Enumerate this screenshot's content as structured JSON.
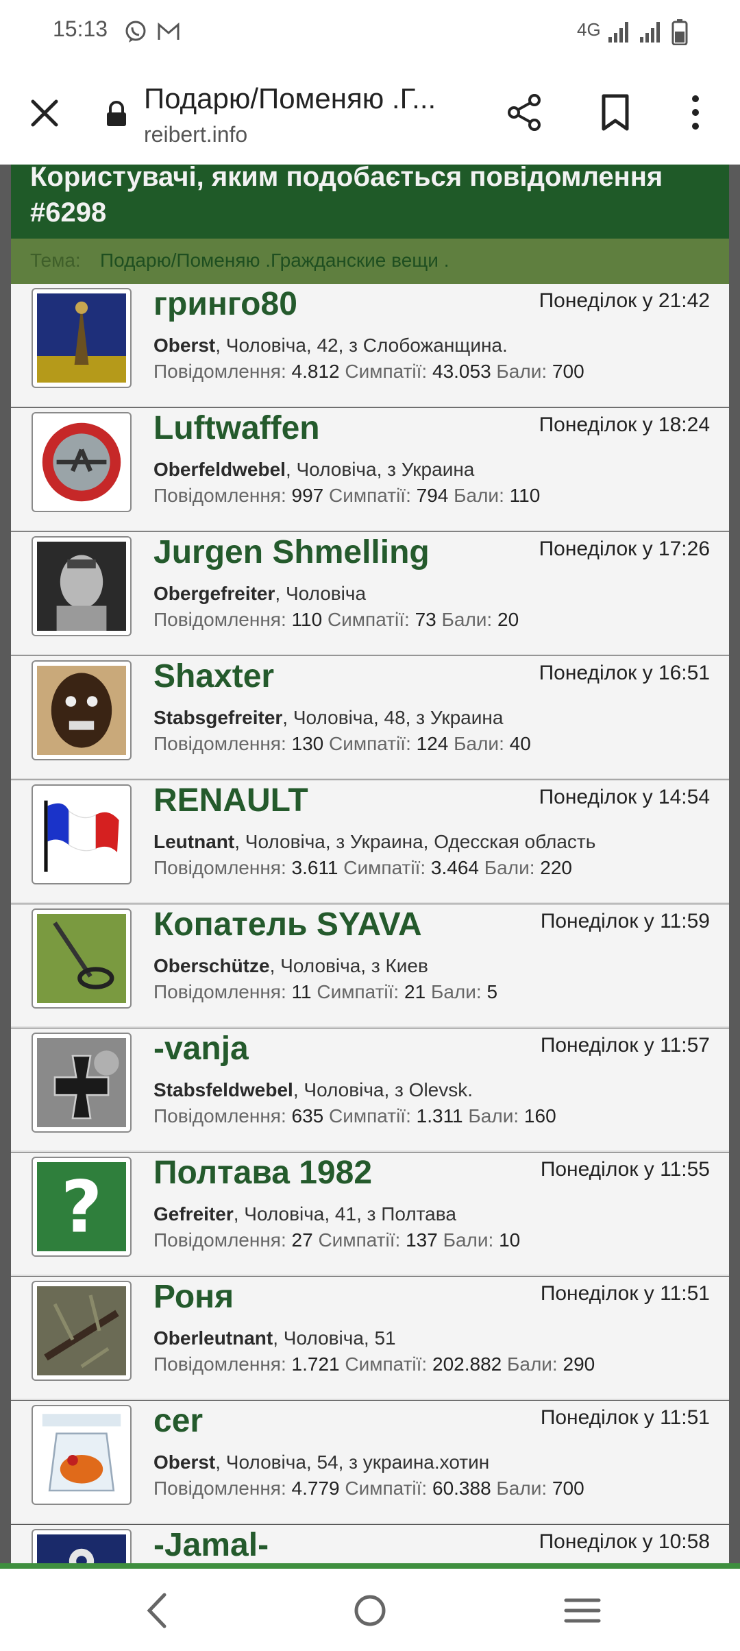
{
  "status_bar": {
    "time": "15:13",
    "network": "4G",
    "icons": [
      "viber-icon",
      "gmail-icon",
      "signal-icon",
      "signal-icon",
      "battery-icon"
    ]
  },
  "toolbar": {
    "title": "Подарю/Поменяю .Г...",
    "url": "reibert.info",
    "icons": [
      "close-icon",
      "lock-icon",
      "share-icon",
      "bookmark-icon",
      "more-vert-icon"
    ]
  },
  "overlay": {
    "title": "Користувачі, яким подобається повідомлення #6298",
    "subject_label": "Тема:",
    "subject_link": "Подарю/Поменяю .Гражданские вещи ."
  },
  "labels": {
    "messages": "Повідомлення:",
    "likes": "Симпатії:",
    "points": "Бали:"
  },
  "users": [
    {
      "name": "гринго80",
      "time": "Понеділок у 21:42",
      "rank": "Oberst",
      "details": ", Чоловіча, 42, з Слобожанщина.",
      "messages": "4.812",
      "likes": "43.053",
      "points": "700"
    },
    {
      "name": "Luftwaffen",
      "time": "Понеділок у 18:24",
      "rank": "Oberfeldwebel",
      "details": ", Чоловіча, з Украина",
      "messages": "997",
      "likes": "794",
      "points": "110"
    },
    {
      "name": "Jurgen Shmelling",
      "time": "Понеділок у 17:26",
      "rank": "Obergefreiter",
      "details": ", Чоловіча",
      "messages": "110",
      "likes": "73",
      "points": "20"
    },
    {
      "name": "Shaxter",
      "time": "Понеділок у 16:51",
      "rank": "Stabsgefreiter",
      "details": ", Чоловіча, 48, з Украина",
      "messages": "130",
      "likes": "124",
      "points": "40"
    },
    {
      "name": "RENAULT",
      "time": "Понеділок у 14:54",
      "rank": "Leutnant",
      "details": ", Чоловіча, з Украина, Одесская область",
      "messages": "3.611",
      "likes": "3.464",
      "points": "220"
    },
    {
      "name": "Копатель SYAVA",
      "time": "Понеділок у 11:59",
      "rank": "Oberschütze",
      "details": ", Чоловіча, з Киев",
      "messages": "11",
      "likes": "21",
      "points": "5"
    },
    {
      "name": "-vanja",
      "time": "Понеділок у 11:57",
      "rank": "Stabsfeldwebel",
      "details": ", Чоловіча, з Olevsk.",
      "messages": "635",
      "likes": "1.311",
      "points": "160"
    },
    {
      "name": "Полтава 1982",
      "time": "Понеділок у 11:55",
      "rank": "Gefreiter",
      "details": ", Чоловіча, 41, з Полтава",
      "messages": "27",
      "likes": "137",
      "points": "10"
    },
    {
      "name": "Роня",
      "time": "Понеділок у 11:51",
      "rank": "Oberleutnant",
      "details": ", Чоловіча, 51",
      "messages": "1.721",
      "likes": "202.882",
      "points": "290"
    },
    {
      "name": "cer",
      "time": "Понеділок у 11:51",
      "rank": "Oberst",
      "details": ", Чоловіча, 54, з украина.хотин",
      "messages": "4.779",
      "likes": "60.388",
      "points": "700"
    },
    {
      "name": "-Jamal-",
      "time": "Понеділок у 10:58",
      "rank": "",
      "details": "",
      "messages": "",
      "likes": "",
      "points": ""
    }
  ],
  "nav": {
    "icons": [
      "back-icon",
      "home-icon",
      "recents-icon"
    ]
  },
  "colors": {
    "forum_green": "#1f5a28",
    "username_green": "#245a2c",
    "accent_line": "#3f8f3f"
  }
}
